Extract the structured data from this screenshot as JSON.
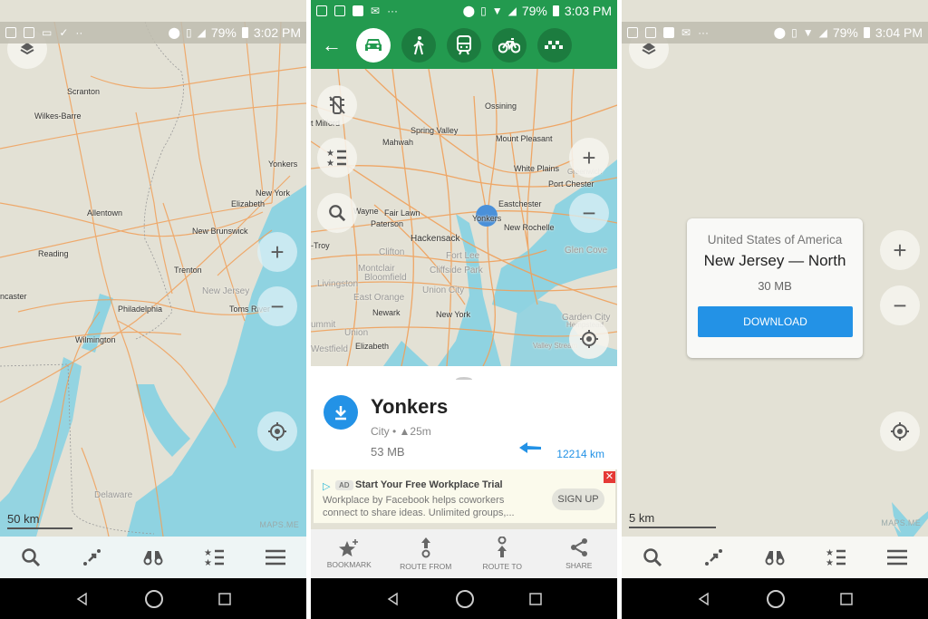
{
  "panels": [
    {
      "status": {
        "battery": "79%",
        "time": "3:02 PM",
        "network": "4G"
      },
      "map_labels": {
        "scranton": "Scranton",
        "wilkes_barre": "Wilkes-Barre",
        "yonkers": "Yonkers",
        "new_york": "New York",
        "elizabeth": "Elizabeth",
        "allentown": "Allentown",
        "new_brunswick": "New Brunswick",
        "reading": "Reading",
        "trenton": "Trenton",
        "new_jersey": "New Jersey",
        "lancaster": "ncaster",
        "philadelphia": "Philadelphia",
        "toms_river": "Toms River",
        "wilmington": "Wilmington",
        "delaware": "Delaware"
      },
      "scale": "50 km",
      "brand": "MAPS.ME"
    },
    {
      "status": {
        "battery": "79%",
        "time": "3:03 PM",
        "network": "LTE"
      },
      "route_modes": [
        "car",
        "pedestrian",
        "transit",
        "bicycle",
        "taxi"
      ],
      "map_labels": {
        "ossining": "Ossining",
        "milford": "t Milford",
        "spring_valley": "Spring Valley",
        "mahwah": "Mahwah",
        "mount_pleasant": "Mount Pleasant",
        "white_plains": "White Plains",
        "greenwich": "Greenwich",
        "port_chester": "Port Chester",
        "eastchester": "Eastchester",
        "wayne": "Wayne",
        "fair_lawn": "Fair Lawn",
        "yonkers": "Yonkers",
        "paterson": "Paterson",
        "new_rochelle": "New Rochelle",
        "hackensack": "Hackensack",
        "troy": "-Troy",
        "clifton": "Clifton",
        "fort_lee": "Fort Lee",
        "glen_cove": "Glen Cove",
        "montclair": "Montclair",
        "bloomfield": "Bloomfield",
        "cliffside_park": "Cliffside Park",
        "livingston": "Livingston",
        "union_city": "Union City",
        "east_orange": "East Orange",
        "newark": "Newark",
        "new_york": "New York",
        "garden_city": "Garden City",
        "hempstead": "Hempstead",
        "summit": "ummit",
        "union": "Union",
        "elizabeth": "Elizabeth",
        "westfield": "Westfield",
        "valley_stream": "Valley Stream"
      },
      "place": {
        "title": "Yonkers",
        "subtitle": "City • ▲25m",
        "size": "53 MB",
        "distance": "12214 km"
      },
      "ad": {
        "badge": "AD",
        "title": "Start Your Free Workplace Trial",
        "body": "Workplace by Facebook helps coworkers connect to share ideas. Unlimited groups,...",
        "cta": "SIGN UP",
        "close": "✕"
      },
      "actions": [
        {
          "label": "BOOKMARK",
          "icon": "bookmark-add-icon"
        },
        {
          "label": "ROUTE FROM",
          "icon": "route-from-icon"
        },
        {
          "label": "ROUTE TO",
          "icon": "route-to-icon"
        },
        {
          "label": "SHARE",
          "icon": "share-icon"
        }
      ]
    },
    {
      "status": {
        "battery": "79%",
        "time": "3:04 PM",
        "network": "LTE"
      },
      "download_card": {
        "country": "United States of America",
        "region": "New Jersey — North",
        "size": "30 MB",
        "button": "DOWNLOAD"
      },
      "scale": "5 km",
      "brand": "MAPS.ME"
    }
  ],
  "bottom_nav": [
    "search",
    "route",
    "discover",
    "bookmarks",
    "menu"
  ],
  "colors": {
    "accent_green": "#239a4f",
    "accent_blue": "#2392e6",
    "road": "#f0a05a",
    "land": "#e3e1d5",
    "water": "#8fd3e1"
  }
}
